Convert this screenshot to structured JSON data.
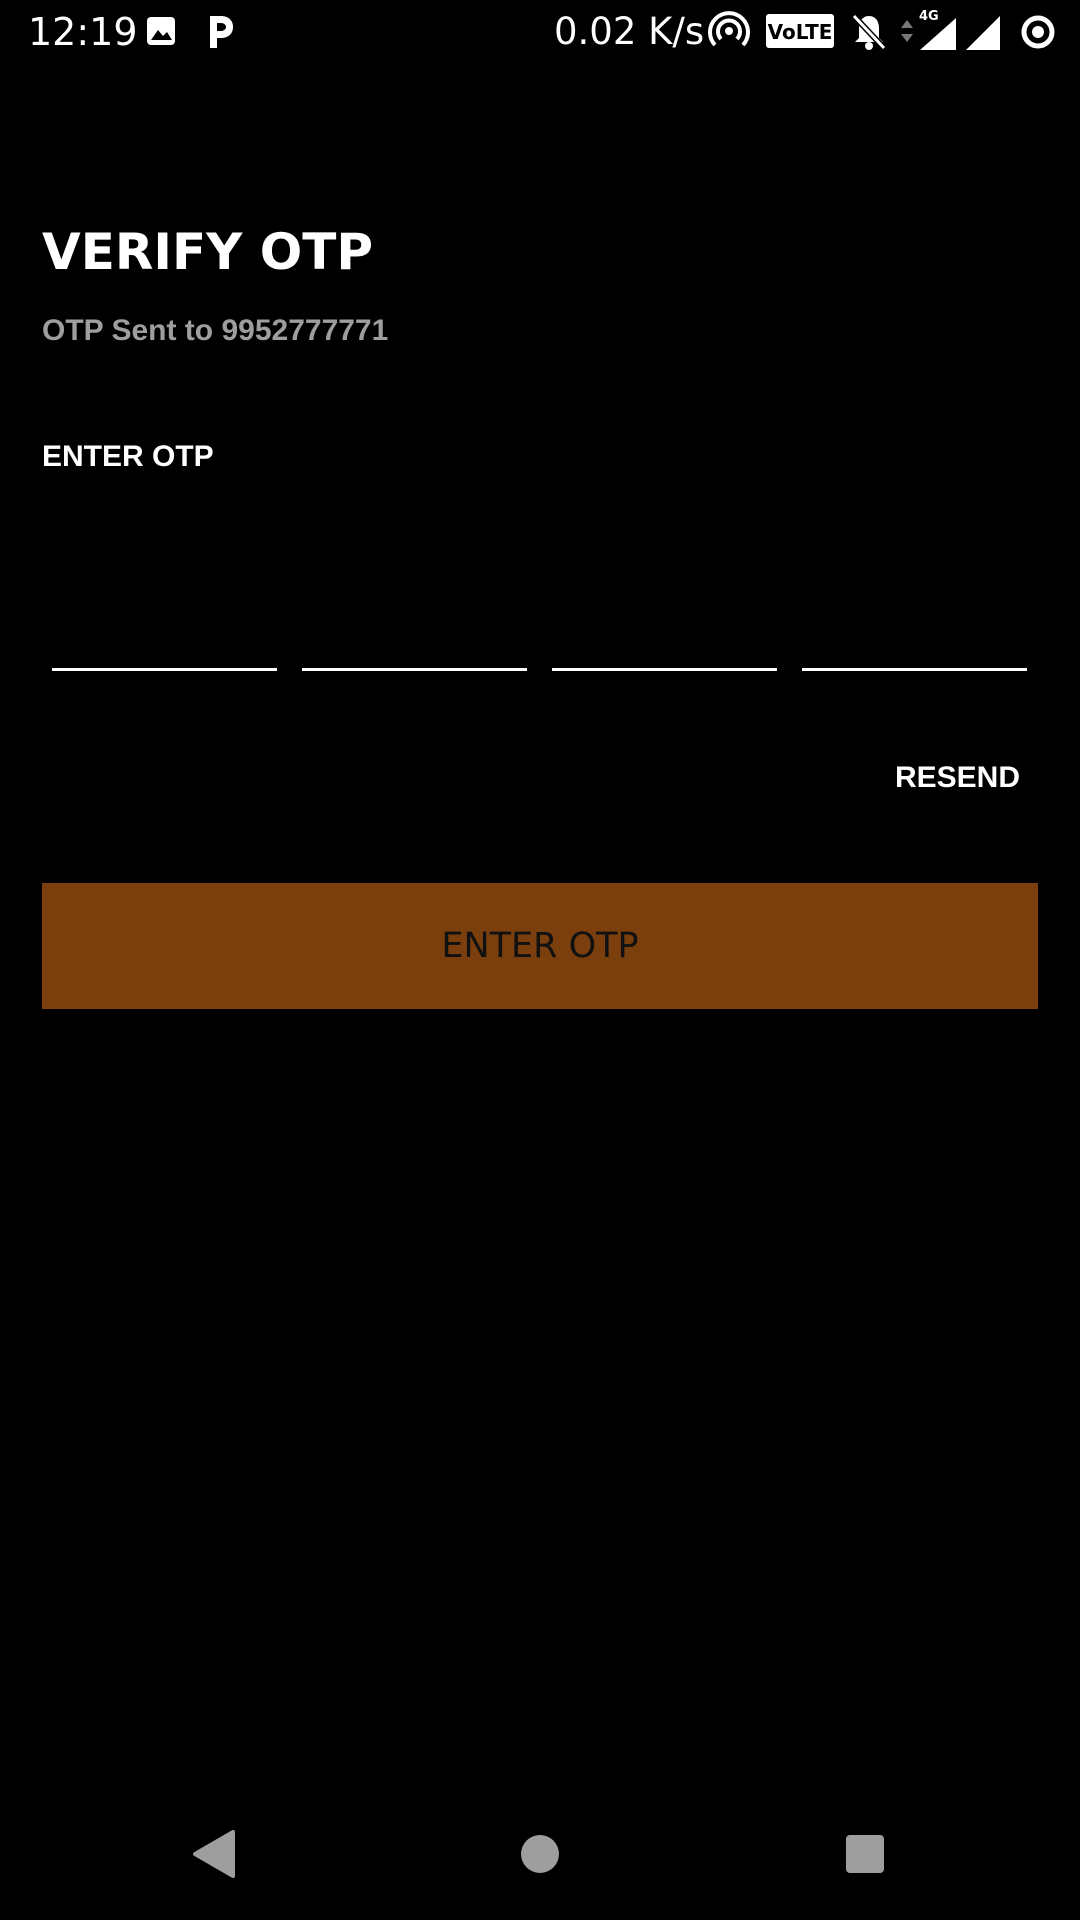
{
  "status_bar": {
    "time": "12:19",
    "network_speed": "0.02 K/s",
    "volte_label": "VoLTE",
    "network_type": "4G",
    "icons": [
      "image-icon",
      "parking-icon",
      "hotspot-icon",
      "volte-icon",
      "bell-off-icon",
      "signal-icon",
      "signal-icon",
      "battery-saver-icon"
    ]
  },
  "screen": {
    "title": "VERIFY OTP",
    "otp_sent_text": "OTP Sent to 9952777771",
    "otp_label": "ENTER OTP",
    "otp_digits": [
      "",
      "",
      "",
      ""
    ],
    "resend_label": "RESEND",
    "submit_label": "ENTER OTP"
  },
  "colors": {
    "background": "#000000",
    "accent_button": "#7b3f0e",
    "subtitle_gray": "#9e9e9e",
    "nav_icon_gray": "#9e9e9e"
  },
  "nav_bar": {
    "icons": [
      "back-icon",
      "home-icon",
      "recents-icon"
    ]
  }
}
